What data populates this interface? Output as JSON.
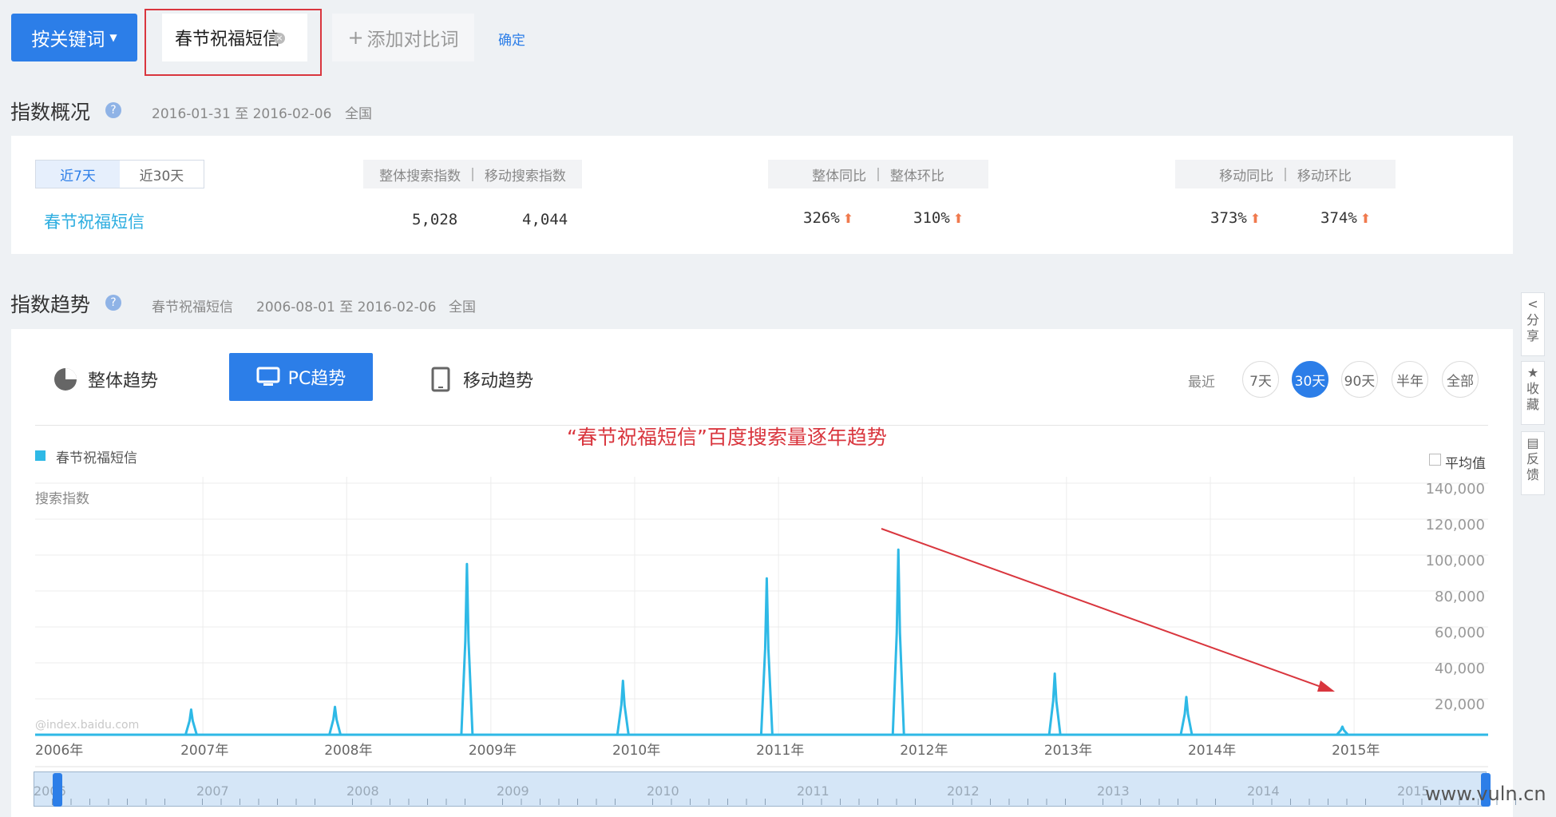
{
  "keyword_bar": {
    "mode_label": "按关键词",
    "keyword": "春节祝福短信",
    "add_label": "添加对比词",
    "confirm_label": "确定"
  },
  "overview": {
    "title": "指数概况",
    "date_range": "2016-01-31 至 2016-02-06",
    "region": "全国",
    "range_tabs": [
      "近7天",
      "近30天"
    ],
    "active_range": "近7天",
    "search_head": [
      "整体搜索指数",
      "移动搜索指数"
    ],
    "overall_head": [
      "整体同比",
      "整体环比"
    ],
    "mobile_head": [
      "移动同比",
      "移动环比"
    ],
    "row": {
      "keyword": "春节祝福短信",
      "overall_index": "5,028",
      "mobile_index": "4,044",
      "overall_yoy": "326%",
      "overall_mom": "310%",
      "mobile_yoy": "373%",
      "mobile_mom": "374%"
    }
  },
  "trend": {
    "title": "指数趋势",
    "keyword": "春节祝福短信",
    "date_range": "2006-08-01 至 2016-02-06",
    "region": "全国",
    "tabs": [
      "整体趋势",
      "PC趋势",
      "移动趋势"
    ],
    "active_tab": "PC趋势",
    "recent_label": "最近",
    "period_pills": [
      "7天",
      "30天",
      "90天",
      "半年",
      "全部"
    ],
    "active_pill": "30天",
    "annotation": "“春节祝福短信”百度搜索量逐年趋势",
    "avg_label": "平均值",
    "legend": "春节祝福短信",
    "chart_watermark": "@index.baidu.com"
  },
  "chart_data": {
    "type": "line",
    "ylabel": "搜索指数",
    "ylim": [
      0,
      140000
    ],
    "y_ticks": [
      "20,000",
      "40,000",
      "60,000",
      "80,000",
      "100,000",
      "120,000",
      "140,000"
    ],
    "x_tick_labels": [
      "2006年",
      "2007年",
      "2008年",
      "2009年",
      "2010年",
      "2011年",
      "2012年",
      "2013年",
      "2014年",
      "2015年"
    ],
    "series": [
      {
        "name": "春节祝福短信",
        "color": "#2eb9e6",
        "peaks": [
          {
            "date": "2007-02",
            "value": 14000
          },
          {
            "date": "2008-02",
            "value": 15500
          },
          {
            "date": "2009-01",
            "value": 95000
          },
          {
            "date": "2010-02",
            "value": 30000
          },
          {
            "date": "2011-02",
            "value": 87000
          },
          {
            "date": "2012-01",
            "value": 103000
          },
          {
            "date": "2013-02",
            "value": 34000
          },
          {
            "date": "2014-01",
            "value": 21000
          },
          {
            "date": "2015-02",
            "value": 4500
          }
        ],
        "baseline": 0
      }
    ],
    "grid": true,
    "legend_position": "top-left"
  },
  "range_selector": {
    "years": [
      "2006",
      "2007",
      "2008",
      "2009",
      "2010",
      "2011",
      "2012",
      "2013",
      "2014",
      "2015"
    ]
  },
  "side_tools": [
    {
      "icon": "share-icon",
      "label": [
        "分",
        "享"
      ]
    },
    {
      "icon": "star-icon",
      "label": [
        "收",
        "藏"
      ]
    },
    {
      "icon": "feedback-icon",
      "label": [
        "反",
        "馈"
      ]
    }
  ],
  "site_watermark": "www.vuln.cn",
  "colors": {
    "accent": "#2c7ee8",
    "series": "#2eb9e6",
    "annotation": "#d9363e",
    "up": "#f07a4e"
  }
}
